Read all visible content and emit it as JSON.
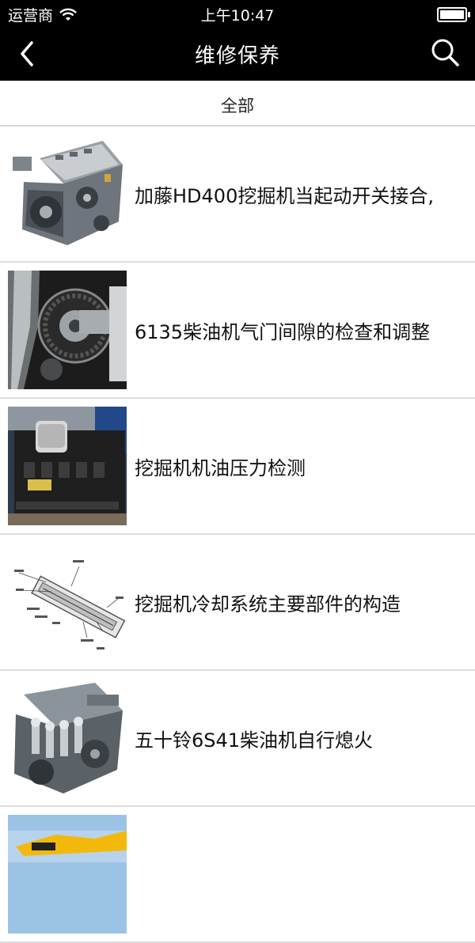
{
  "status_bar": {
    "carrier": "运营商",
    "time": "上午10:47"
  },
  "nav": {
    "title": "维修保养"
  },
  "filter": {
    "label": "全部"
  },
  "items": [
    {
      "title": "加藤HD400挖掘机当起动开关接合,",
      "thumb": "engine-photo"
    },
    {
      "title": "6135柴油机气门间隙的检查和调整",
      "thumb": "timing-gear-photo"
    },
    {
      "title": "挖掘机机油压力检测",
      "thumb": "diesel-engine-photo"
    },
    {
      "title": "挖掘机冷却系统主要部件的构造",
      "thumb": "cooling-diagram"
    },
    {
      "title": "五十铃6S41柴油机自行熄火",
      "thumb": "engine-cutaway-photo"
    },
    {
      "title": "",
      "thumb": "excavator-photo"
    }
  ]
}
